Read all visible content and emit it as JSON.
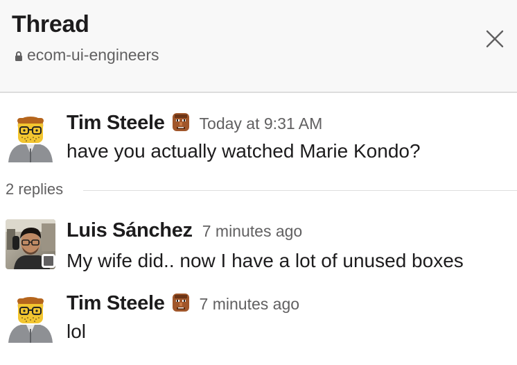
{
  "thread": {
    "title": "Thread",
    "channel": "ecom-ui-engineers",
    "close_icon": "close-icon",
    "lock_icon": "lock-icon"
  },
  "parent_message": {
    "author": "Tim Steele",
    "status_emoji": "doom-face-emoji",
    "timestamp": "Today at 9:31 AM",
    "text": "have you actually watched Marie Kondo?"
  },
  "replies_count": "2 replies",
  "replies": [
    {
      "author": "Luis Sánchez",
      "timestamp": "7 minutes ago",
      "text": "My wife did.. now I have a lot of unused boxes",
      "presence": "away"
    },
    {
      "author": "Tim Steele",
      "status_emoji": "doom-face-emoji",
      "timestamp": "7 minutes ago",
      "text": "lol"
    }
  ],
  "colors": {
    "header_bg": "#f8f8f8",
    "text_primary": "#1d1c1d",
    "text_secondary": "#616061",
    "divider": "#dddddd"
  }
}
